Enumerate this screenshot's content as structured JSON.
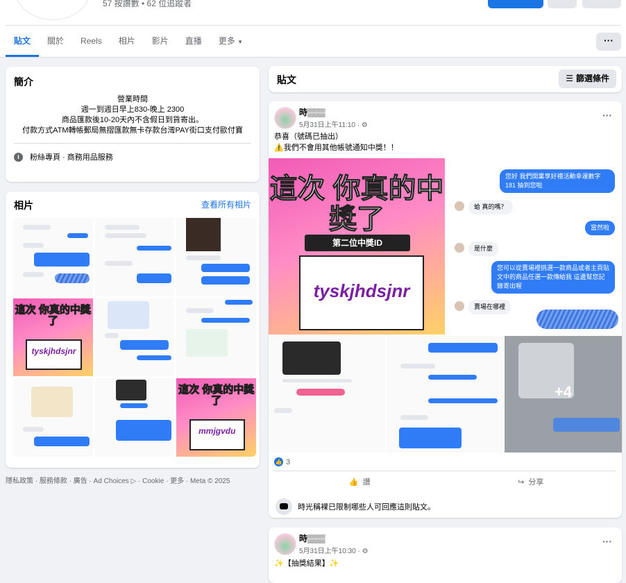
{
  "header": {
    "stats": "57 按讚數 • 62 位追蹤者"
  },
  "tabs": [
    {
      "label": "貼文"
    },
    {
      "label": "關於"
    },
    {
      "label": "Reels"
    },
    {
      "label": "相片"
    },
    {
      "label": "影片"
    },
    {
      "label": "直播"
    },
    {
      "label": "更多"
    }
  ],
  "more_button": "···",
  "intro": {
    "title": "簡介",
    "lines": [
      "營業時間",
      "週一到週日早上830-晚上 2300",
      "商品匯款後10-20天內不含假日到貨寄出。",
      "付款方式ATM轉帳郵局無摺匯款無卡存款台灣PAY街口支付歐付寶"
    ],
    "category": "粉絲專頁 · 商務用品服務"
  },
  "photos": {
    "title": "相片",
    "see_all": "查看所有相片",
    "promo_ids": [
      "tyskjhdsjnr",
      "mmjgvdu"
    ],
    "promo_title": "這次 你真的中獎了"
  },
  "footer": "隱私政策 · 服務條款 · 廣告 · Ad Choices ▷ · Cookie · 更多 · Meta © 2025",
  "posts_header": {
    "title": "貼文",
    "filter": "篩選條件"
  },
  "post1": {
    "name": "時▒▒▒",
    "meta": "5月31日上午11:10 · ⚙",
    "text_line1": "恭喜（號碼已抽出）",
    "text_line2": "⚠️我們不會用其他帳號通知中獎！！",
    "promo_title": "這次 你真的中獎了",
    "promo_sub": "第二位中獎ID",
    "promo_id": "tyskjhdsjnr",
    "chat": [
      {
        "side": "right",
        "text": "您好 我們開業享好禮活動幸運數字 181 抽到您啦"
      },
      {
        "side": "left",
        "text": "蛤 真的嗎？"
      },
      {
        "side": "right",
        "text": "當然啦"
      },
      {
        "side": "left",
        "text": "是什麼"
      },
      {
        "side": "right",
        "text": "您可以從賣場裡挑選一款商品或者主頁貼文中的商品任選一款傳給我 這邊幫您記錄寄出喔"
      },
      {
        "side": "left",
        "text": "賣場在哪裡"
      }
    ],
    "extra_count": "+4",
    "reactions": "3",
    "like_label": "讚",
    "share_label": "分享",
    "limit_text": "時光稱裸已限制哪些人可回應這則貼文。"
  },
  "post2": {
    "name": "時▒▒▒",
    "meta": "5月31日上午10:30 · ⚙",
    "text": "✨【抽獎結果】✨"
  }
}
